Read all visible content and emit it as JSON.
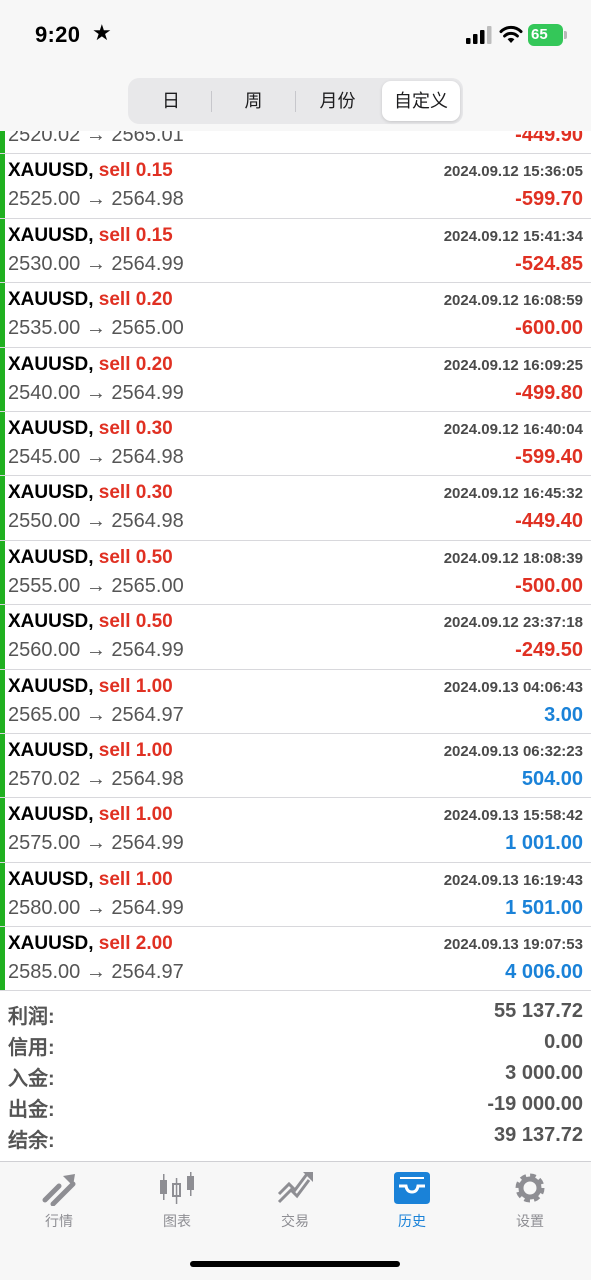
{
  "status_bar": {
    "time": "9:20",
    "battery": "65"
  },
  "period_tabs": [
    {
      "label": "日",
      "selected": false
    },
    {
      "label": "周",
      "selected": false
    },
    {
      "label": "月份",
      "selected": false
    },
    {
      "label": "自定义",
      "selected": true
    }
  ],
  "colors": {
    "loss": "#e03022",
    "profit": "#1a82d8",
    "row_bar": "#20b020",
    "active_tab": "#1a82d8"
  },
  "partial_top_row": {
    "prices": "2520.02 → 2565.01",
    "profit": "-449.90"
  },
  "trades": [
    {
      "symbol": "XAUUSD,",
      "side": "sell 0.15",
      "time": "2024.09.12 15:36:05",
      "prices": "2525.00 → 2564.98",
      "profit": "-599.70",
      "negative": true
    },
    {
      "symbol": "XAUUSD,",
      "side": "sell 0.15",
      "time": "2024.09.12 15:41:34",
      "prices": "2530.00 → 2564.99",
      "profit": "-524.85",
      "negative": true
    },
    {
      "symbol": "XAUUSD,",
      "side": "sell 0.20",
      "time": "2024.09.12 16:08:59",
      "prices": "2535.00 → 2565.00",
      "profit": "-600.00",
      "negative": true
    },
    {
      "symbol": "XAUUSD,",
      "side": "sell 0.20",
      "time": "2024.09.12 16:09:25",
      "prices": "2540.00 → 2564.99",
      "profit": "-499.80",
      "negative": true
    },
    {
      "symbol": "XAUUSD,",
      "side": "sell 0.30",
      "time": "2024.09.12 16:40:04",
      "prices": "2545.00 → 2564.98",
      "profit": "-599.40",
      "negative": true
    },
    {
      "symbol": "XAUUSD,",
      "side": "sell 0.30",
      "time": "2024.09.12 16:45:32",
      "prices": "2550.00 → 2564.98",
      "profit": "-449.40",
      "negative": true
    },
    {
      "symbol": "XAUUSD,",
      "side": "sell 0.50",
      "time": "2024.09.12 18:08:39",
      "prices": "2555.00 → 2565.00",
      "profit": "-500.00",
      "negative": true
    },
    {
      "symbol": "XAUUSD,",
      "side": "sell 0.50",
      "time": "2024.09.12 23:37:18",
      "prices": "2560.00 → 2564.99",
      "profit": "-249.50",
      "negative": true
    },
    {
      "symbol": "XAUUSD,",
      "side": "sell 1.00",
      "time": "2024.09.13 04:06:43",
      "prices": "2565.00 → 2564.97",
      "profit": "3.00",
      "negative": false
    },
    {
      "symbol": "XAUUSD,",
      "side": "sell 1.00",
      "time": "2024.09.13 06:32:23",
      "prices": "2570.02 → 2564.98",
      "profit": "504.00",
      "negative": false
    },
    {
      "symbol": "XAUUSD,",
      "side": "sell 1.00",
      "time": "2024.09.13 15:58:42",
      "prices": "2575.00 → 2564.99",
      "profit": "1 001.00",
      "negative": false
    },
    {
      "symbol": "XAUUSD,",
      "side": "sell 1.00",
      "time": "2024.09.13 16:19:43",
      "prices": "2580.00 → 2564.99",
      "profit": "1 501.00",
      "negative": false
    },
    {
      "symbol": "XAUUSD,",
      "side": "sell 2.00",
      "time": "2024.09.13 19:07:53",
      "prices": "2585.00 → 2564.97",
      "profit": "4 006.00",
      "negative": false
    }
  ],
  "summary": [
    {
      "label": "利润:",
      "value": "55 137.72"
    },
    {
      "label": "信用:",
      "value": "0.00"
    },
    {
      "label": "入金:",
      "value": "3 000.00"
    },
    {
      "label": "出金:",
      "value": "-19 000.00"
    },
    {
      "label": "结余:",
      "value": "39 137.72"
    }
  ],
  "tab_bar": [
    {
      "label": "行情",
      "icon": "quotes-icon",
      "active": false
    },
    {
      "label": "图表",
      "icon": "chart-icon",
      "active": false
    },
    {
      "label": "交易",
      "icon": "trade-icon",
      "active": false
    },
    {
      "label": "历史",
      "icon": "history-icon",
      "active": true
    },
    {
      "label": "设置",
      "icon": "settings-icon",
      "active": false
    }
  ]
}
